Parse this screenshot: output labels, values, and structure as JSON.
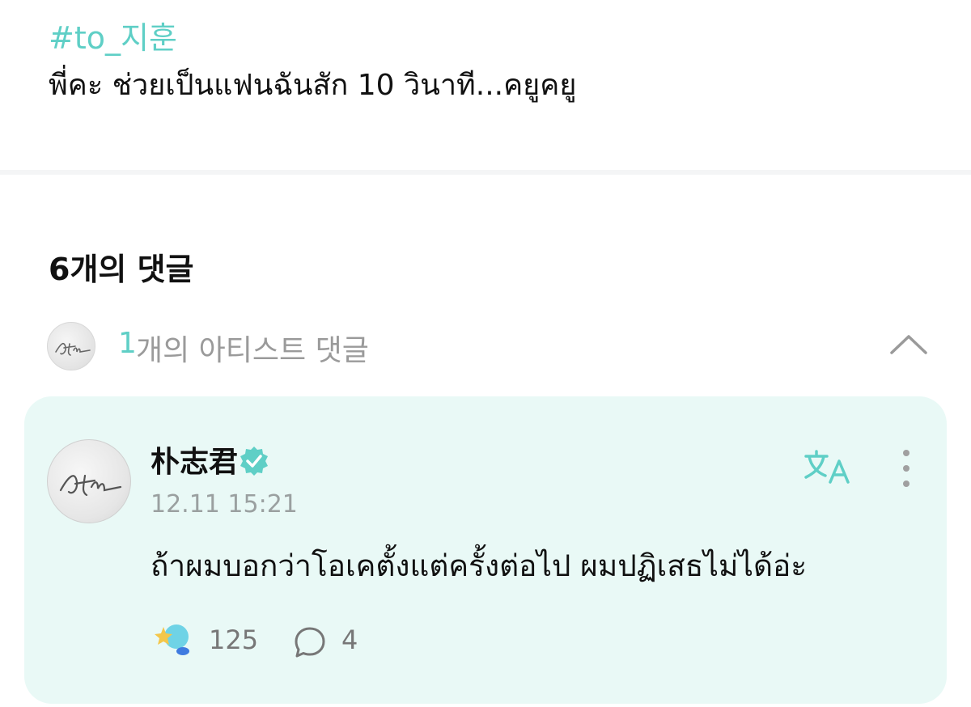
{
  "post": {
    "tag": "#to_지훈",
    "body": "พี่คะ ช่วยเป็นแฟนฉันสัก 10 วินาที...คยูคยู"
  },
  "comments": {
    "title": "6개의 댓글",
    "artist_summary": {
      "count": "1",
      "label": "개의 아티스트 댓글"
    }
  },
  "comment": {
    "author": "朴志君",
    "timestamp": "12.11 15:21",
    "text": "ถ้าผมบอกว่าโอเคตั้งแต่ครั้งต่อไป ผมปฏิเสธไม่ได้อ่ะ",
    "likes": "125",
    "replies": "4"
  },
  "icons": {
    "verified": "verified-badge-icon",
    "translate": "translate-icon",
    "more": "more-vertical-icon",
    "collapse": "chevron-up-icon",
    "reaction": "star-lightstick-icon",
    "reply": "speech-bubble-icon"
  },
  "colors": {
    "accent": "#5fcfc6",
    "card_background": "#e9f9f6",
    "muted_text": "#9a9a9a"
  }
}
